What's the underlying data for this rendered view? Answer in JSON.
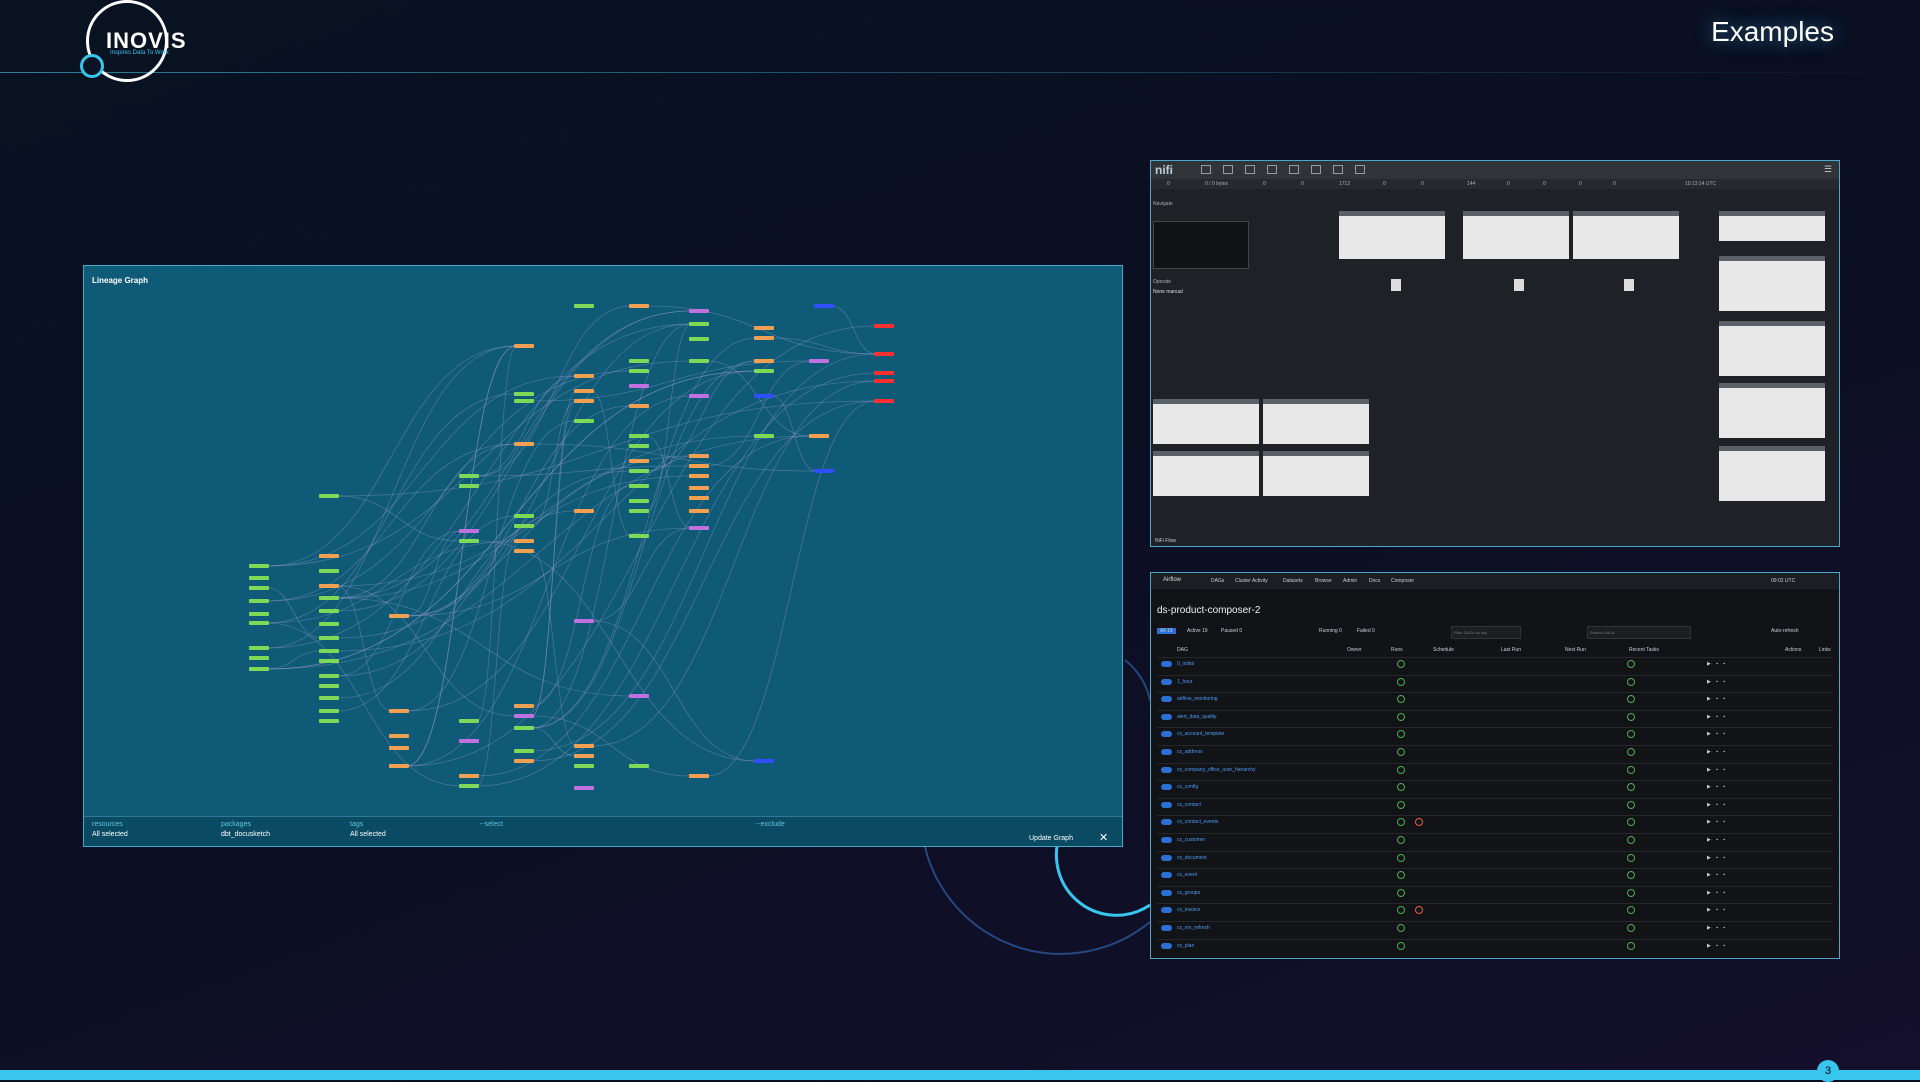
{
  "slide": {
    "title": "Examples",
    "page_number": "3"
  },
  "logo": {
    "name": "INOVIS",
    "tagline": "Inspires Data To Work"
  },
  "lineage": {
    "title": "Lineage Graph",
    "filters": [
      {
        "label": "resources",
        "value": "All selected"
      },
      {
        "label": "packages",
        "value": "dbt_docusketch"
      },
      {
        "label": "tags",
        "value": "All selected"
      },
      {
        "label": "--select",
        "value": ""
      },
      {
        "label": "--exclude",
        "value": ""
      }
    ],
    "update_button": "Update Graph",
    "close_icon": "close-icon",
    "node_colors": {
      "green": "#7ed957",
      "orange": "#f0a050",
      "purple": "#c070e0",
      "red": "#ff3030",
      "blue": "#3050ff"
    }
  },
  "nifi": {
    "logo": "nifi",
    "time": "10:13:14 UTC",
    "status_counts": [
      "0",
      "0 / 0 bytes",
      "0",
      "0",
      "1712",
      "0",
      "0",
      "144",
      "0",
      "0",
      "0",
      "0"
    ],
    "navigate_label": "Navigate",
    "operate_label": "Operate",
    "operate_selection": "None manual",
    "footer": "NiFi Flow"
  },
  "airflow": {
    "brand": "Airflow",
    "nav": [
      "DAGs",
      "Cluster Activity",
      "Datasets",
      "Browse",
      "Admin",
      "Docs",
      "Composer"
    ],
    "time": "09:02 UTC",
    "heading": "ds-product-composer-2",
    "tabs": [
      "All",
      "Active",
      "Paused",
      "Running",
      "Failed"
    ],
    "tab_counts": [
      "19",
      "19",
      "0",
      "0",
      "0"
    ],
    "filter_placeholder": "Filter DAGs by tag",
    "search_placeholder": "Search DAGs",
    "auto_refresh": "Auto-refresh",
    "columns": [
      "DAG",
      "Owner",
      "Runs",
      "Schedule",
      "Last Run",
      "Next Run",
      "Recent Tasks",
      "Actions",
      "Links"
    ],
    "rows": [
      {
        "dag": "0_initial",
        "failed": false
      },
      {
        "dag": "1_hour",
        "failed": false
      },
      {
        "dag": "airflow_monitoring",
        "failed": false
      },
      {
        "dag": "alert_data_quality",
        "failed": false
      },
      {
        "dag": "cs_account_template",
        "failed": false
      },
      {
        "dag": "cs_address",
        "failed": false
      },
      {
        "dag": "cs_company_office_user_hierarchy",
        "failed": false
      },
      {
        "dag": "cs_config",
        "failed": false
      },
      {
        "dag": "cs_contact",
        "failed": false
      },
      {
        "dag": "cs_contact_events",
        "failed": true
      },
      {
        "dag": "cs_customer",
        "failed": false
      },
      {
        "dag": "cs_document",
        "failed": false
      },
      {
        "dag": "cs_event",
        "failed": false
      },
      {
        "dag": "cs_groups",
        "failed": false
      },
      {
        "dag": "cs_invoice",
        "failed": true
      },
      {
        "dag": "cs_mv_refresh",
        "failed": false
      },
      {
        "dag": "cs_plan",
        "failed": false
      }
    ]
  }
}
